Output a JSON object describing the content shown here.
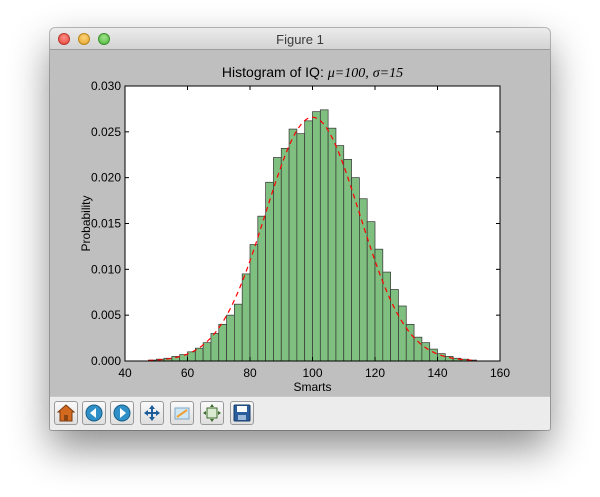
{
  "window": {
    "title": "Figure 1"
  },
  "toolbar": {
    "buttons": [
      {
        "name": "home-button",
        "icon": "home-icon"
      },
      {
        "name": "back-button",
        "icon": "arrow-left-icon"
      },
      {
        "name": "forward-button",
        "icon": "arrow-right-icon"
      },
      {
        "name": "pan-button",
        "icon": "move-arrows-icon"
      },
      {
        "name": "zoom-button",
        "icon": "zoom-rect-icon"
      },
      {
        "name": "configure-subplots-button",
        "icon": "subplots-icon"
      },
      {
        "name": "save-button",
        "icon": "floppy-disk-icon"
      }
    ]
  },
  "chart_data": {
    "type": "bar",
    "title": "Histogram of IQ: μ=100, σ=15",
    "title_prefix": "Histogram of IQ: ",
    "title_mu": "μ=100,",
    "title_sigma": "σ=15",
    "xlabel": "Smarts",
    "ylabel": "Probability",
    "xlim": [
      40,
      160
    ],
    "ylim": [
      0,
      0.03
    ],
    "xticks": [
      "40",
      "60",
      "80",
      "100",
      "120",
      "140",
      "160"
    ],
    "yticks": [
      "0.000",
      "0.005",
      "0.010",
      "0.015",
      "0.020",
      "0.025",
      "0.030"
    ],
    "bin_width": 2.5,
    "bins_start": [
      47.5,
      50,
      52.5,
      55,
      57.5,
      60,
      62.5,
      65,
      67.5,
      70,
      72.5,
      75,
      77.5,
      80,
      82.5,
      85,
      87.5,
      90,
      92.5,
      95,
      97.5,
      100,
      102.5,
      105,
      107.5,
      110,
      112.5,
      115,
      117.5,
      120,
      122.5,
      125,
      127.5,
      130,
      132.5,
      135,
      137.5,
      140,
      142.5,
      145,
      147.5,
      150
    ],
    "values": [
      0.0001,
      0.0002,
      0.0003,
      0.0005,
      0.0007,
      0.001,
      0.0014,
      0.002,
      0.003,
      0.004,
      0.005,
      0.0062,
      0.0095,
      0.0127,
      0.0158,
      0.0195,
      0.0222,
      0.0232,
      0.0253,
      0.0248,
      0.0262,
      0.0272,
      0.0274,
      0.0254,
      0.0235,
      0.022,
      0.02,
      0.0177,
      0.0152,
      0.0122,
      0.0097,
      0.0078,
      0.006,
      0.004,
      0.0026,
      0.002,
      0.0013,
      0.0008,
      0.0005,
      0.0003,
      0.0002,
      0.0001
    ],
    "bar_color": "#7fbf7f",
    "bar_edge_color": "#333333",
    "pdf_line": {
      "style": "dashed",
      "color": "#ff0000",
      "mu": 100,
      "sigma": 15
    },
    "grid": false
  }
}
